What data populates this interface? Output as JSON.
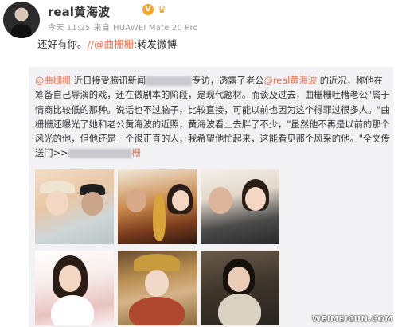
{
  "header": {
    "username": "real黄海波",
    "verified_badge": "V",
    "meta": {
      "time": "今天 11:25",
      "source_prefix": "来自",
      "device": "HUAWEI Mate 20 Pro"
    }
  },
  "post": {
    "text_before": "还好有你。",
    "mention": "//@曲栅栅",
    "text_after": ":转发微博"
  },
  "repost": {
    "mention": "@曲栅栅",
    "seg1": " 近日接受腾讯新闻",
    "seg2": "专访，透露了老公",
    "mention2": "@real黄海波",
    "seg3": " 的近况，称他在筹备自己导演的戏，还在做剧本的阶段，是现代题材。而谈及过去，曲栅栅吐槽老公\"属于情商比较低的那种。说话也不过脑子，比较直接，可能以前也因为这个得罪过很多人。\"曲栅栅还曝光了她和老公黄海波的近照，黄海波看上去胖了不少，\"虽然他不再是以前的那个风光的他，但他还是一个很正直的人，我希望他忙起来，这能看见那个风采的他。\"全文传送门>>",
    "trailing": "栅"
  },
  "watermark": "WEIMEICUN.COM",
  "colors": {
    "link": "#eb7350",
    "repost_bg": "#f2f2f5",
    "badge": "#f5a623"
  }
}
